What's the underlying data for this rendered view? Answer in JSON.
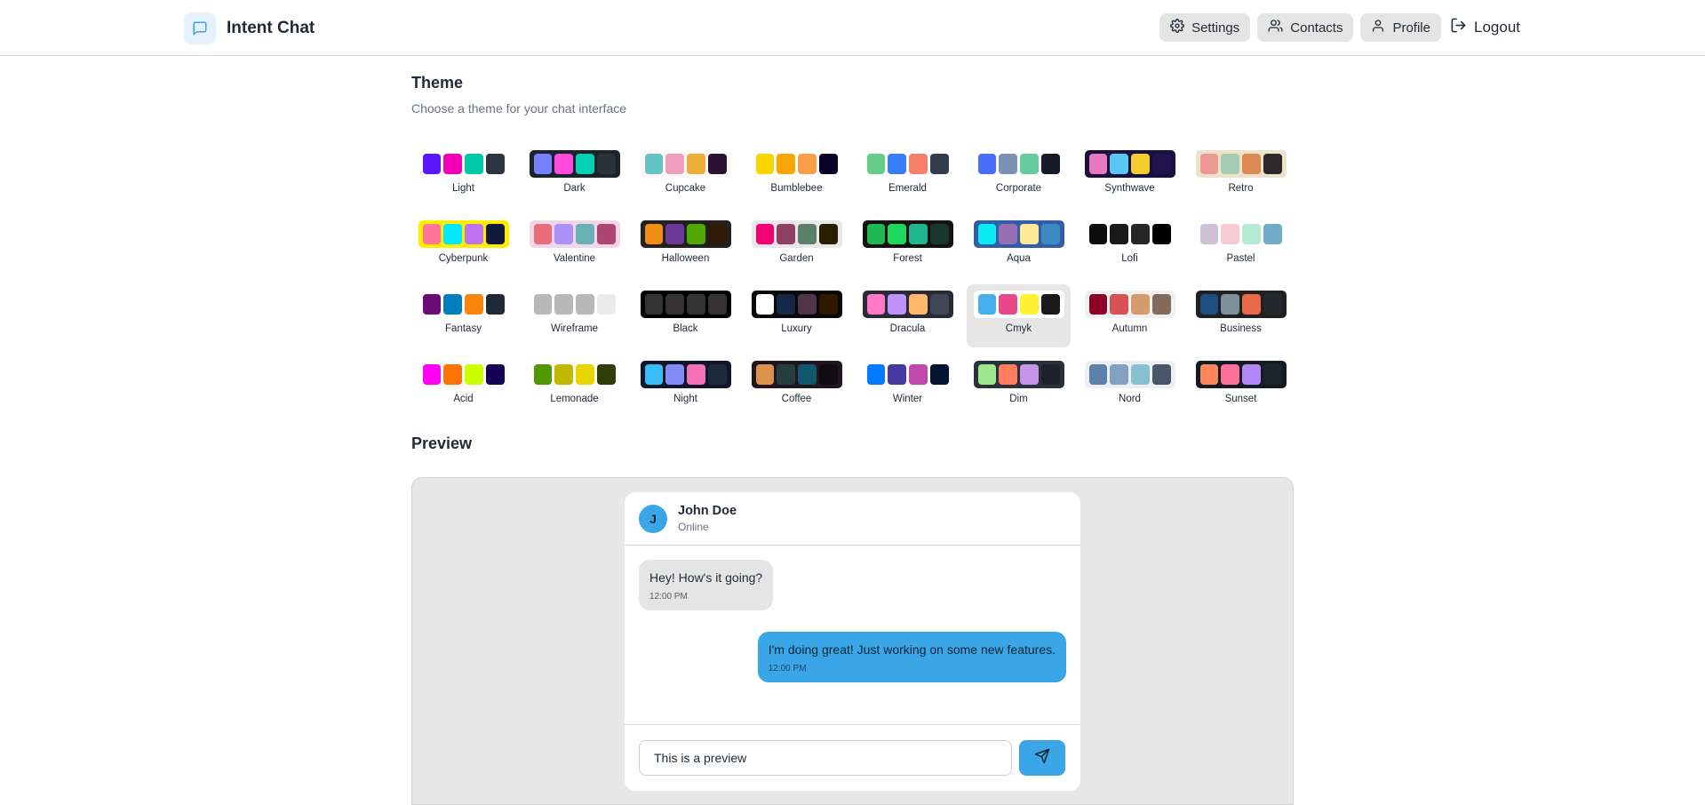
{
  "app": {
    "title": "Intent Chat"
  },
  "nav": {
    "settings": "Settings",
    "contacts": "Contacts",
    "profile": "Profile",
    "logout": "Logout"
  },
  "theme_section": {
    "title": "Theme",
    "subtitle": "Choose a theme for your chat interface",
    "selected": "Cmyk",
    "themes": [
      {
        "name": "Light",
        "bg": "#ffffff",
        "colors": [
          "#5b16f8",
          "#f000b8",
          "#00c9a7",
          "#2b3440"
        ]
      },
      {
        "name": "Dark",
        "bg": "#1d232a",
        "colors": [
          "#7582ff",
          "#ff49db",
          "#00d1b2",
          "#2a323c"
        ]
      },
      {
        "name": "Cupcake",
        "bg": "#faf7f5",
        "colors": [
          "#65c3c8",
          "#ef9fbc",
          "#eeaf3a",
          "#291334"
        ]
      },
      {
        "name": "Bumblebee",
        "bg": "#ffffff",
        "colors": [
          "#fbd500",
          "#f8a600",
          "#f99e48",
          "#080327"
        ]
      },
      {
        "name": "Emerald",
        "bg": "#ffffff",
        "colors": [
          "#66cc8a",
          "#377cfb",
          "#f68067",
          "#333c4d"
        ]
      },
      {
        "name": "Corporate",
        "bg": "#ffffff",
        "colors": [
          "#4b6bfb",
          "#7b92b2",
          "#67cba0",
          "#181a2a"
        ]
      },
      {
        "name": "Synthwave",
        "bg": "#1a103d",
        "colors": [
          "#e779c1",
          "#58c7f3",
          "#f3cc30",
          "#20134e"
        ]
      },
      {
        "name": "Retro",
        "bg": "#ece3ca",
        "colors": [
          "#ef9995",
          "#a4cbb4",
          "#dc8850",
          "#2e282a"
        ]
      },
      {
        "name": "Cyberpunk",
        "bg": "#ffee00",
        "colors": [
          "#ff7598",
          "#00e8ff",
          "#c071f0",
          "#111a3b"
        ]
      },
      {
        "name": "Valentine",
        "bg": "#f0d6e8",
        "colors": [
          "#e96d7b",
          "#a991f7",
          "#66b1b3",
          "#af4670"
        ]
      },
      {
        "name": "Halloween",
        "bg": "#212121",
        "colors": [
          "#f28c18",
          "#6d3a9c",
          "#51a800",
          "#2f1b05"
        ]
      },
      {
        "name": "Garden",
        "bg": "#e9e7e7",
        "colors": [
          "#f40076",
          "#8e4162",
          "#5c7f67",
          "#291e00"
        ]
      },
      {
        "name": "Forest",
        "bg": "#171212",
        "colors": [
          "#1eb854",
          "#1fd65f",
          "#1db88e",
          "#19362d"
        ]
      },
      {
        "name": "Aqua",
        "bg": "#345da7",
        "colors": [
          "#09ecf3",
          "#966fb3",
          "#ffe999",
          "#3b8ac4"
        ]
      },
      {
        "name": "Lofi",
        "bg": "#ffffff",
        "colors": [
          "#0d0d0d",
          "#1a1919",
          "#262626",
          "#000000"
        ]
      },
      {
        "name": "Pastel",
        "bg": "#ffffff",
        "colors": [
          "#d1c1d7",
          "#f6cbd1",
          "#b4e9d6",
          "#70acc7"
        ]
      },
      {
        "name": "Fantasy",
        "bg": "#ffffff",
        "colors": [
          "#6e0b75",
          "#007ebd",
          "#f8860d",
          "#1f2937"
        ]
      },
      {
        "name": "Wireframe",
        "bg": "#ffffff",
        "colors": [
          "#b8b8b8",
          "#b8b8b8",
          "#b8b8b8",
          "#ebebeb"
        ]
      },
      {
        "name": "Black",
        "bg": "#000000",
        "colors": [
          "#343232",
          "#343232",
          "#343232",
          "#343232"
        ]
      },
      {
        "name": "Luxury",
        "bg": "#09090b",
        "colors": [
          "#ffffff",
          "#152747",
          "#513448",
          "#331800"
        ]
      },
      {
        "name": "Dracula",
        "bg": "#282a36",
        "colors": [
          "#ff79c6",
          "#bd93f9",
          "#ffb86c",
          "#414558"
        ]
      },
      {
        "name": "Cmyk",
        "bg": "#ffffff",
        "colors": [
          "#45aeee",
          "#e8488a",
          "#fff232",
          "#1a1a1a"
        ]
      },
      {
        "name": "Autumn",
        "bg": "#f1f1f1",
        "colors": [
          "#8c0327",
          "#d85251",
          "#d59b6a",
          "#826a5c"
        ]
      },
      {
        "name": "Business",
        "bg": "#202020",
        "colors": [
          "#1c4e80",
          "#7c909a",
          "#ea6947",
          "#23282e"
        ]
      },
      {
        "name": "Acid",
        "bg": "#fafafa",
        "colors": [
          "#ff00f4",
          "#ff7400",
          "#cbfd03",
          "#140055"
        ]
      },
      {
        "name": "Lemonade",
        "bg": "#ffffff",
        "colors": [
          "#519903",
          "#c0b801",
          "#e8d600",
          "#313c07"
        ]
      },
      {
        "name": "Night",
        "bg": "#0f1729",
        "colors": [
          "#38bdf8",
          "#818cf8",
          "#f471b5",
          "#1e293b"
        ]
      },
      {
        "name": "Coffee",
        "bg": "#20161f",
        "colors": [
          "#db924b",
          "#263e3f",
          "#10576d",
          "#120c12"
        ]
      },
      {
        "name": "Winter",
        "bg": "#ffffff",
        "colors": [
          "#047aff",
          "#463aa2",
          "#c148ac",
          "#021431"
        ]
      },
      {
        "name": "Dim",
        "bg": "#2a303c",
        "colors": [
          "#9fe88d",
          "#ff7d5c",
          "#c792e9",
          "#1c212b"
        ]
      },
      {
        "name": "Nord",
        "bg": "#eceff4",
        "colors": [
          "#5e81ac",
          "#81a1c1",
          "#88c0d0",
          "#4c566a"
        ]
      },
      {
        "name": "Sunset",
        "bg": "#121c22",
        "colors": [
          "#ff865b",
          "#fd6f9c",
          "#b387fa",
          "#1b262c"
        ]
      }
    ]
  },
  "preview": {
    "title": "Preview",
    "contact": {
      "initial": "J",
      "name": "John Doe",
      "status": "Online"
    },
    "messages": [
      {
        "text": "Hey! How's it going?",
        "time": "12:00 PM",
        "direction": "in"
      },
      {
        "text": "I'm doing great! Just working on some new features.",
        "time": "12:00 PM",
        "direction": "out"
      }
    ],
    "input_value": "This is a preview",
    "colors": {
      "primary": "#3aa6e8",
      "incoming_bubble": "#e5e5e5"
    }
  },
  "icons": {
    "brand": "chat-bubble-icon",
    "settings": "gear-icon",
    "contacts": "users-icon",
    "profile": "user-icon",
    "logout": "logout-icon",
    "send": "send-icon"
  }
}
